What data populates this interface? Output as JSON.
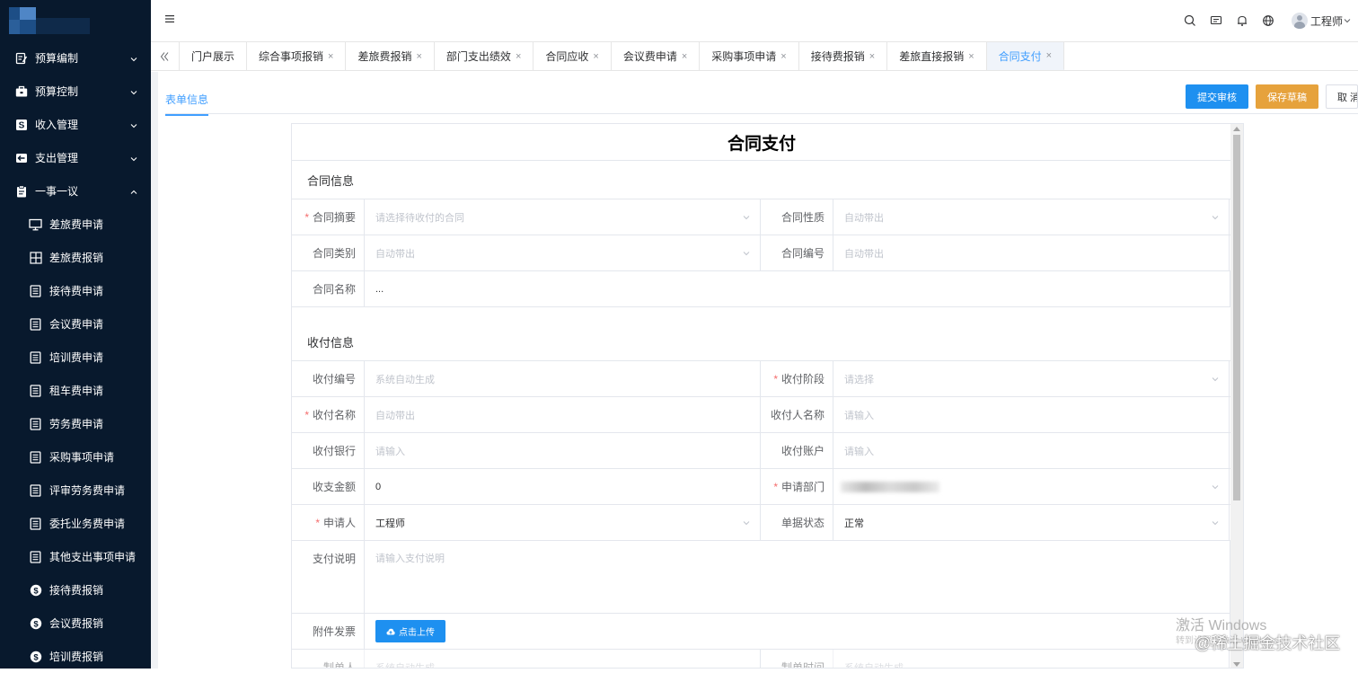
{
  "sidebar": {
    "menus": [
      {
        "label": "预算编制",
        "icon": "budget-edit-icon"
      },
      {
        "label": "预算控制",
        "icon": "budget-control-icon"
      },
      {
        "label": "收入管理",
        "icon": "income-icon"
      },
      {
        "label": "支出管理",
        "icon": "expense-icon"
      },
      {
        "label": "一事一议",
        "icon": "clipboard-icon"
      }
    ],
    "sub_items": [
      {
        "label": "差旅费申请",
        "icon": "monitor-icon"
      },
      {
        "label": "差旅费报销",
        "icon": "grid-icon"
      },
      {
        "label": "接待费申请",
        "icon": "doc-icon"
      },
      {
        "label": "会议费申请",
        "icon": "doc-icon"
      },
      {
        "label": "培训费申请",
        "icon": "doc-icon"
      },
      {
        "label": "租车费申请",
        "icon": "doc-icon"
      },
      {
        "label": "劳务费申请",
        "icon": "doc-icon"
      },
      {
        "label": "采购事项申请",
        "icon": "doc-icon"
      },
      {
        "label": "评审劳务费申请",
        "icon": "doc-icon"
      },
      {
        "label": "委托业务费申请",
        "icon": "doc-icon"
      },
      {
        "label": "其他支出事项申请",
        "icon": "doc-icon"
      },
      {
        "label": "接待费报销",
        "icon": "dollar-circle-icon"
      },
      {
        "label": "会议费报销",
        "icon": "dollar-circle-icon"
      },
      {
        "label": "培训费报销",
        "icon": "dollar-circle-icon"
      }
    ]
  },
  "header": {
    "user_name": "工程师",
    "icons": [
      "search-icon",
      "message-icon",
      "bell-icon",
      "globe-icon"
    ]
  },
  "tabs": [
    {
      "label": "门户展示",
      "closable": false
    },
    {
      "label": "综合事项报销",
      "closable": true
    },
    {
      "label": "差旅费报销",
      "closable": true
    },
    {
      "label": "部门支出绩效",
      "closable": true
    },
    {
      "label": "合同应收",
      "closable": true
    },
    {
      "label": "会议费申请",
      "closable": true
    },
    {
      "label": "采购事项申请",
      "closable": true
    },
    {
      "label": "接待费报销",
      "closable": true
    },
    {
      "label": "差旅直接报销",
      "closable": true
    },
    {
      "label": "合同支付",
      "closable": true,
      "active": true
    }
  ],
  "tab_close_glyph": "×",
  "form_tab": "表单信息",
  "actions": {
    "submit": "提交审核",
    "save": "保存草稿",
    "cancel": "取 消"
  },
  "form": {
    "title": "合同支付",
    "contract_section": "合同信息",
    "contract_summary": {
      "label": "合同摘要",
      "placeholder": "请选择待收付的合同"
    },
    "contract_nature": {
      "label": "合同性质",
      "placeholder": "自动带出"
    },
    "contract_type": {
      "label": "合同类别",
      "placeholder": "自动带出"
    },
    "contract_no": {
      "label": "合同编号",
      "placeholder": "自动带出"
    },
    "contract_name": {
      "label": "合同名称",
      "value": "..."
    },
    "payment_section": "收付信息",
    "pay_no": {
      "label": "收付编号",
      "placeholder": "系统自动生成"
    },
    "pay_stage": {
      "label": "收付阶段",
      "placeholder": "请选择"
    },
    "pay_name": {
      "label": "收付名称",
      "placeholder": "自动带出"
    },
    "payee_name": {
      "label": "收付人名称",
      "placeholder": "请输入"
    },
    "pay_bank": {
      "label": "收付银行",
      "placeholder": "请输入"
    },
    "pay_account": {
      "label": "收付账户",
      "placeholder": "请输入"
    },
    "amount": {
      "label": "收支金额",
      "value": "0"
    },
    "department": {
      "label": "申请部门"
    },
    "applicant": {
      "label": "申请人",
      "value": "工程师"
    },
    "doc_status": {
      "label": "单据状态",
      "value": "正常"
    },
    "pay_desc": {
      "label": "支付说明",
      "placeholder": "请输入支付说明"
    },
    "attachment": {
      "label": "附件发票",
      "button": "点击上传"
    },
    "maker": {
      "label": "制单人",
      "placeholder": "系统自动生成"
    },
    "make_time": {
      "label": "制单时间",
      "placeholder": "系统自动生成"
    }
  },
  "watermark": {
    "windows": "激活 Windows",
    "windows_sub": "转到设置以激活 Windows",
    "juejin": "@稀土掘金技术社区"
  }
}
